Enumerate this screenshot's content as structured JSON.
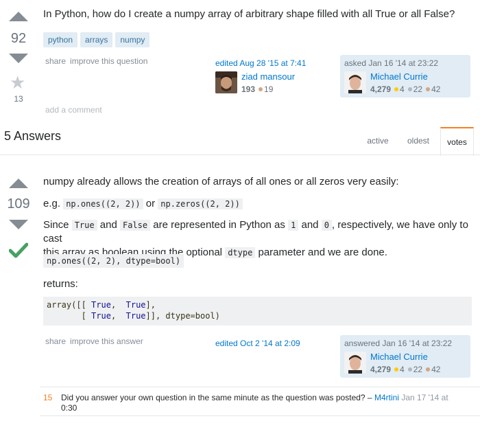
{
  "question": {
    "title": "In Python, how do I create a numpy array of arbitrary shape filled with all True or all False?",
    "votes": "92",
    "favorites": "13",
    "tags": [
      "python",
      "arrays",
      "numpy"
    ],
    "menu": [
      "share",
      "improve this question"
    ],
    "edited": {
      "label": "edited Aug 28 '15 at 7:41",
      "user": "ziad mansour",
      "rep": "193",
      "bronze": "19"
    },
    "asked": {
      "label": "asked Jan 16 '14 at 23:22",
      "user": "Michael Currie",
      "rep": "4,279",
      "gold": "4",
      "silver": "22",
      "bronze": "42"
    },
    "add_comment": "add a comment"
  },
  "answers_header": {
    "count_label": "5 Answers",
    "tabs": [
      "active",
      "oldest",
      "votes"
    ],
    "active_tab": "votes"
  },
  "answer": {
    "votes": "109",
    "p1": "numpy already allows the creation of arrays of all ones or all zeros very easily:",
    "p2_prefix": "e.g.",
    "code_ones": "np.ones((2, 2))",
    "p2_or": "or",
    "code_zeros": "np.zeros((2, 2))",
    "p3_since": "Since",
    "code_true": "True",
    "p3_and": "and",
    "code_false": "False",
    "p3_mid": "are represented in Python as",
    "code_1": "1",
    "p3_and2": "and",
    "code_0": "0",
    "p3_end": ", respectively, we have only to cast",
    "p3_line2_pre": "this array as boolean using the optional",
    "code_dtype": "dtype",
    "p3_line2_post": "parameter and we are done.",
    "code_call": "np.ones((2, 2), dtype=bool)",
    "returns": "returns:",
    "code_block": {
      "l1_pre": "array([[ ",
      "l1_kw1": "True",
      "l1_mid": ",  ",
      "l1_kw2": "True",
      "l1_post": "],",
      "l2_pre": "       [ ",
      "l2_kw1": "True",
      "l2_mid": ",  ",
      "l2_kw2": "True",
      "l2_post": "]], dtype=bool)"
    },
    "menu": [
      "share",
      "improve this answer"
    ],
    "edited": "edited Oct 2 '14 at 2:09",
    "answered": {
      "label": "answered Jan 16 '14 at 23:22",
      "user": "Michael Currie",
      "rep": "4,279",
      "gold": "4",
      "silver": "22",
      "bronze": "42"
    }
  },
  "comment": {
    "score": "15",
    "text": "Did you answer your own question in the same minute as the question was posted? –",
    "user": "M4rtini",
    "date": "Jan 17 '14 at",
    "date2": "0:30"
  },
  "colors": {
    "gold": "#ffcc01",
    "silver": "#b4b8bc",
    "bronze": "#d1a684",
    "link": "#0077cc",
    "accept": "#45a163"
  }
}
